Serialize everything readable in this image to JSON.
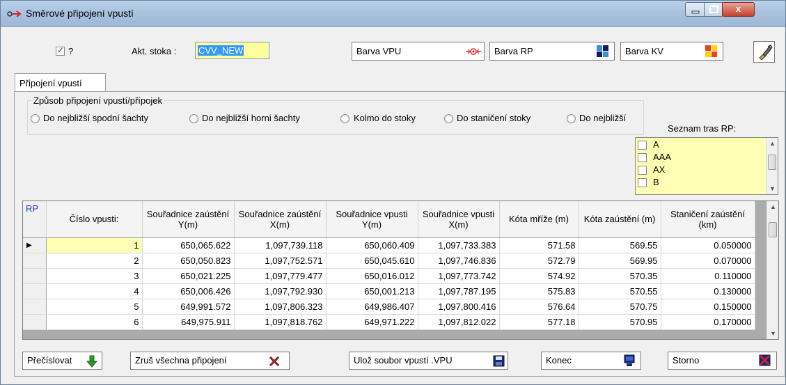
{
  "window": {
    "title": "Směrové připojení vpustí",
    "controls": {
      "close": "x"
    }
  },
  "toolbar": {
    "check_label": "?",
    "check_checked": true,
    "akt_label": "Akt. stoka :",
    "akt_value": "CVV_NEW",
    "barva_vpu": "Barva VPU",
    "barva_rp": "Barva RP",
    "barva_kv": "Barva KV"
  },
  "tabs": [
    {
      "label": "Připojení vpustí"
    }
  ],
  "mode_group": {
    "title": "Způsob připojení vpustí/přípojek",
    "options": [
      "Do nejbližší spodní šachty",
      "Do nejbližší horni šachty",
      "Kolmo do stoky",
      "Do staničení stoky",
      "Do nejbližší"
    ]
  },
  "routes": {
    "label": "Seznam tras RP:",
    "items": [
      "A",
      "AAA",
      "AX",
      "B"
    ]
  },
  "grid": {
    "rp_header": "RP",
    "columns": [
      "Číslo  vpusti:",
      "Souřadnice zaústění Y(m)",
      "Souřadnice zaústění X(m)",
      "Souřadnice vpusti Y(m)",
      "Souřadnice vpusti X(m)",
      "Kóta mříže (m)",
      "Kóta zaústění (m)",
      "Staničení zaústění (km)"
    ],
    "rows": [
      [
        "1",
        "650,065.622",
        "1,097,739.118",
        "650,060.409",
        "1,097,733.383",
        "571.58",
        "569.55",
        "0.050000"
      ],
      [
        "2",
        "650,050.823",
        "1,097,752.571",
        "650,045.610",
        "1,097,746.836",
        "572.79",
        "569.95",
        "0.070000"
      ],
      [
        "3",
        "650,021.225",
        "1,097,779.477",
        "650,016.012",
        "1,097,773.742",
        "574.92",
        "570.35",
        "0.110000"
      ],
      [
        "4",
        "650,006.426",
        "1,097,792.930",
        "650,001.213",
        "1,097,787.195",
        "575.83",
        "570.55",
        "0.130000"
      ],
      [
        "5",
        "649,991.572",
        "1,097,806.323",
        "649,986.407",
        "1,097,800.416",
        "576.64",
        "570.75",
        "0.150000"
      ],
      [
        "6",
        "649,975.911",
        "1,097,818.762",
        "649,971.222",
        "1,097,812.022",
        "577.18",
        "570.95",
        "0.170000"
      ]
    ]
  },
  "buttons": {
    "renumber": "Přečíslovat",
    "clear_all": "Zruš všechna připojení",
    "save_file": "Ulož soubor vpustí .VPU",
    "end": "Konec",
    "cancel": "Storno"
  },
  "colors": {
    "input_bg": "#ffff9c",
    "selection": "#3399ff",
    "list_bg": "#ffffb4",
    "rp_text": "#1a3fb0"
  }
}
